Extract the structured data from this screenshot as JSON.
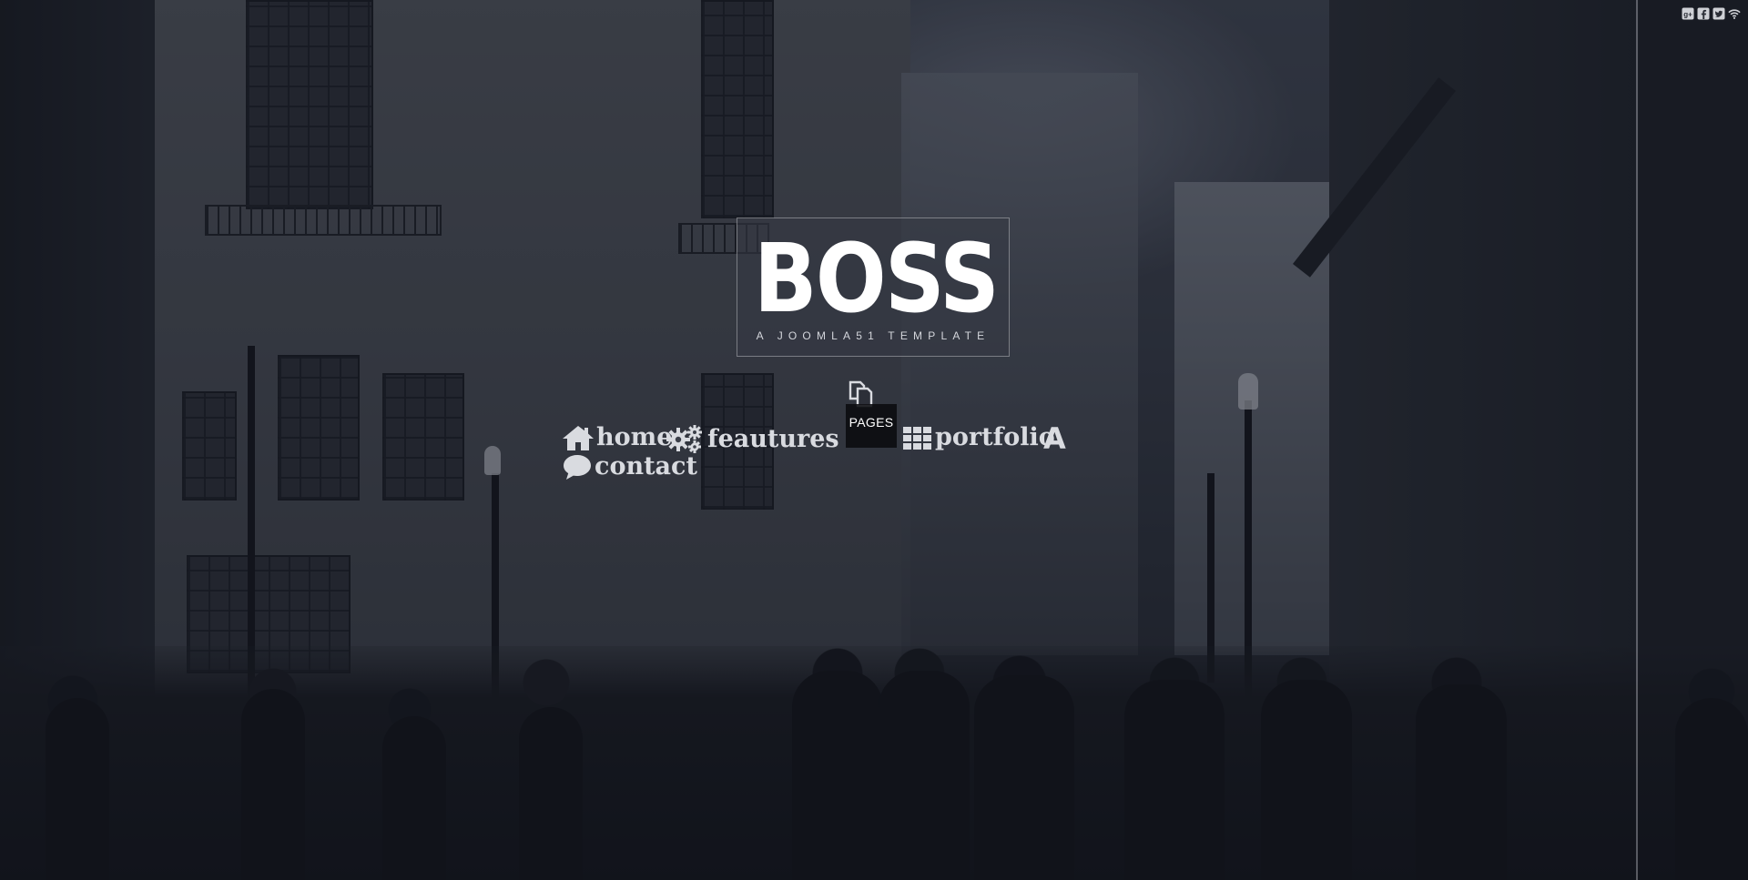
{
  "logo": {
    "title": "BOSS",
    "subtitle": "A JOOMLA51 TEMPLATE"
  },
  "nav": {
    "items": [
      {
        "label": "home",
        "icon": "home-icon"
      },
      {
        "label": "feautures",
        "icon": "gears-icon"
      },
      {
        "label": "PAGES",
        "icon": "copy-icon"
      },
      {
        "label": "portfolio",
        "icon": "grid-icon"
      },
      {
        "label": "",
        "icon": "font-a-icon"
      },
      {
        "label": "contact",
        "icon": "comment-icon"
      }
    ],
    "a_glyph": "A"
  },
  "social": {
    "icons": [
      "google-plus-icon",
      "facebook-icon",
      "twitter-icon",
      "rss-icon"
    ]
  },
  "colors": {
    "overlay": "#161a26",
    "nav_text": "#d9dbe0",
    "pages_bg": "#0a0b0f"
  }
}
